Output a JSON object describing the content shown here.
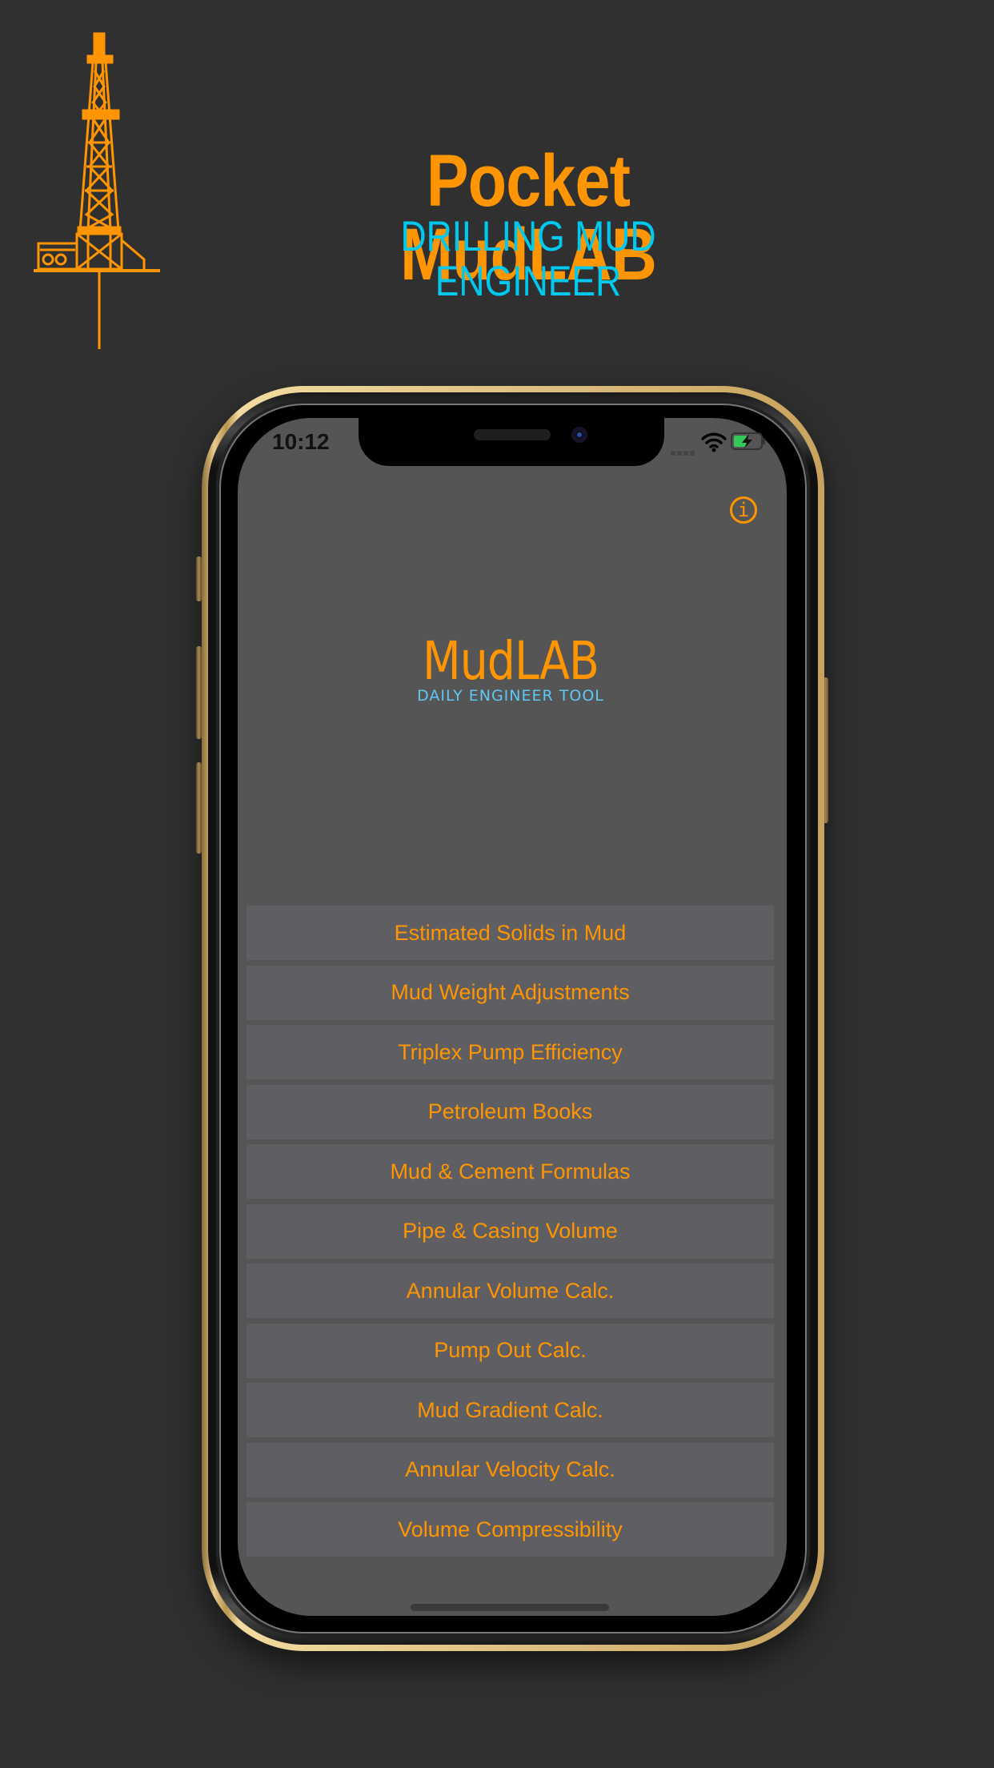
{
  "promo": {
    "title": "Pocket MudLAB",
    "subtitle": "DRILLING MUD ENGINEER",
    "logo_icon": "drilling-rig-icon"
  },
  "status_bar": {
    "time": "10:12",
    "icons": [
      "cellular-signal-icon",
      "wifi-icon",
      "battery-charging-icon"
    ]
  },
  "app": {
    "info_icon": "info-icon",
    "info_glyph": "i",
    "title": "MudLAB",
    "subtitle": "DAILY ENGINEER TOOL"
  },
  "menu": {
    "items": [
      {
        "label": "Estimated Solids in Mud"
      },
      {
        "label": "Mud Weight Adjustments"
      },
      {
        "label": "Triplex Pump Efficiency"
      },
      {
        "label": "Petroleum Books"
      },
      {
        "label": "Mud & Cement Formulas"
      },
      {
        "label": "Pipe & Casing Volume"
      },
      {
        "label": "Annular Volume Calc."
      },
      {
        "label": "Pump Out Calc."
      },
      {
        "label": "Mud Gradient Calc."
      },
      {
        "label": "Annular Velocity Calc."
      },
      {
        "label": "Volume Compressibility"
      }
    ]
  },
  "colors": {
    "accent": "#ff9500",
    "subtitle_blue": "#00c8ef",
    "app_sub_blue": "#5ec8f5",
    "background": "#303030",
    "screen_bg": "#555555",
    "button_bg": "#5f5f63",
    "battery_green": "#34c759"
  }
}
